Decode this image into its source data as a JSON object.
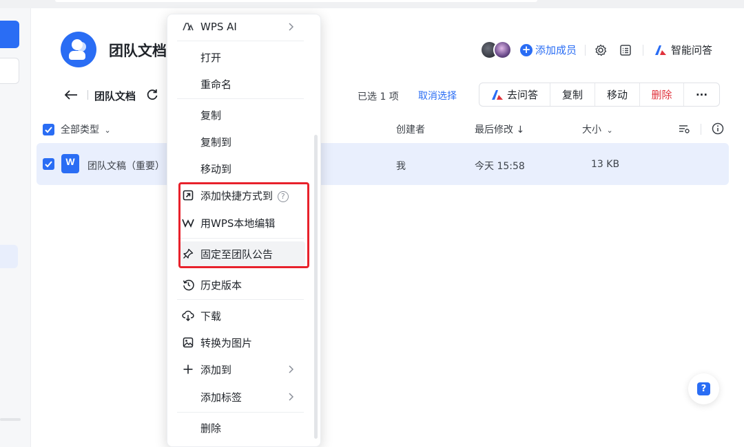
{
  "header": {
    "team_title": "团队文档",
    "add_member_label": "添加成员",
    "ai_qa_label": "智能问答"
  },
  "breadcrumb": {
    "title": "团队文档"
  },
  "selection": {
    "count_text": "已选 1 项",
    "cancel_label": "取消选择"
  },
  "action_bar": {
    "ask_label": "去问答",
    "copy_label": "复制",
    "move_label": "移动",
    "delete_label": "删除",
    "more_label": "···"
  },
  "table": {
    "type_filter": "全部类型",
    "columns": {
      "creator": "创建者",
      "modified": "最后修改 ↓",
      "size": "大小"
    },
    "rows": [
      {
        "name": "团队文稿（重要）",
        "creator": "我",
        "modified": "今天 15:58",
        "size": "13 KB"
      }
    ]
  },
  "context_menu": {
    "items": [
      {
        "label": "WPS AI",
        "icon": "wps-ai-icon",
        "submenu": true
      },
      {
        "label": "打开"
      },
      {
        "label": "重命名"
      },
      {
        "label": "复制"
      },
      {
        "label": "复制到"
      },
      {
        "label": "移动到"
      },
      {
        "label": "添加快捷方式到",
        "icon": "shortcut-icon"
      },
      {
        "label": "用WPS本地编辑",
        "icon": "wps-icon"
      },
      {
        "label": "固定至团队公告",
        "icon": "pin-icon",
        "highlighted": true
      },
      {
        "label": "历史版本",
        "icon": "history-icon"
      },
      {
        "label": "下载",
        "icon": "cloud-download-icon"
      },
      {
        "label": "转换为图片",
        "icon": "image-icon"
      },
      {
        "label": "添加到",
        "icon": "plus-icon",
        "submenu": true
      },
      {
        "label": "添加标签",
        "submenu": true
      },
      {
        "label": "删除"
      }
    ]
  },
  "colors": {
    "accent": "#2a6df4",
    "danger": "#e0323c",
    "annotation_box": "#e8212b",
    "selected_row": "#e9effd"
  }
}
